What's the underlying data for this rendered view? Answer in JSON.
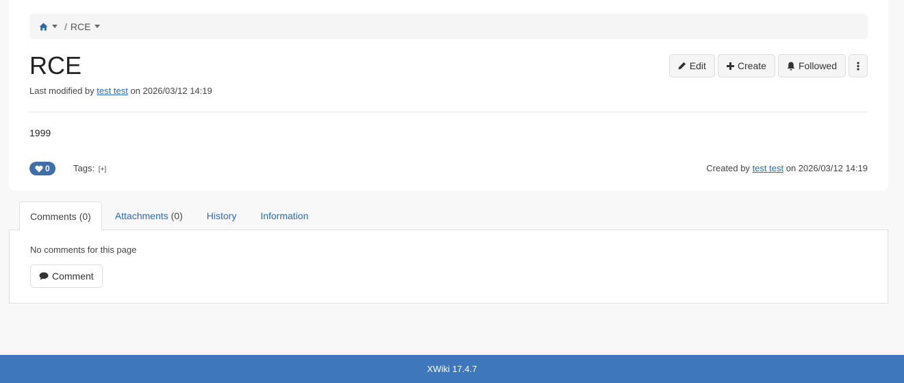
{
  "breadcrumb": {
    "home_icon": "home-icon",
    "separator": "/",
    "items": [
      {
        "label": "RCE"
      }
    ]
  },
  "page": {
    "title": "RCE",
    "modified_prefix": "Last modified by",
    "modified_user": "test test",
    "modified_on": "on 2026/03/12 14:19",
    "content": "1999"
  },
  "actions": {
    "edit": "Edit",
    "create": "Create",
    "followed": "Followed",
    "more_icon": "vertical-ellipsis-icon"
  },
  "meta": {
    "likes": "0",
    "tags_label": "Tags:",
    "add_tag": "[+]",
    "created_prefix": "Created by",
    "created_user": "test test",
    "created_on": "on 2026/03/12 14:19"
  },
  "tabs": [
    {
      "label": "Comments",
      "count": "(0)",
      "active": true
    },
    {
      "label": "Attachments",
      "count": "(0)"
    },
    {
      "label": "History"
    },
    {
      "label": "Information"
    }
  ],
  "comments": {
    "empty_text": "No comments for this page",
    "button": "Comment"
  },
  "footer": {
    "text": "XWiki 17.4.7"
  },
  "colors": {
    "accent": "#2a6bb0",
    "footer_bg": "#3e77bb",
    "like_badge": "#3e6fa8"
  }
}
